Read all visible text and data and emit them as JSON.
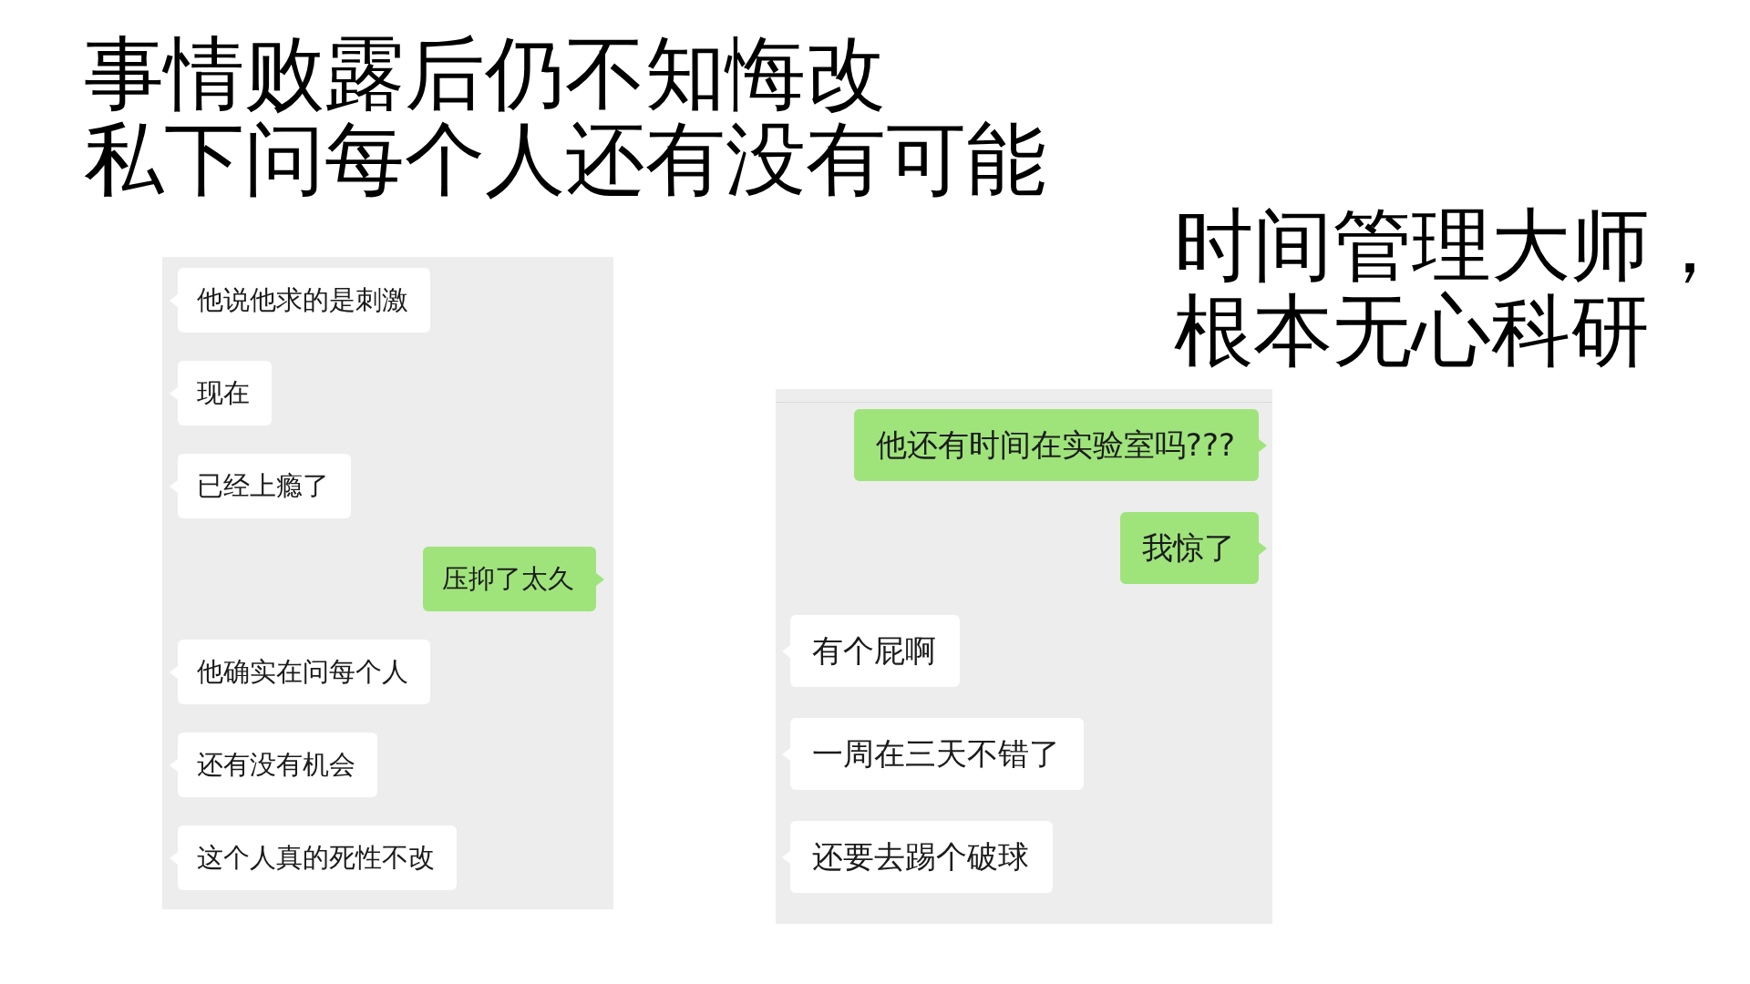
{
  "headline": {
    "lines": [
      "事情败露后仍不知悔改",
      "私下问每个人还有没有可能"
    ]
  },
  "chats": [
    {
      "messages": [
        {
          "kind": "received",
          "text": "他说他求的是刺激"
        },
        {
          "kind": "received",
          "text": "现在"
        },
        {
          "kind": "received",
          "text": "已经上瘾了"
        },
        {
          "kind": "sent",
          "text": "压抑了太久"
        },
        {
          "kind": "received",
          "text": "他确实在问每个人"
        },
        {
          "kind": "received",
          "text": "还有没有机会"
        },
        {
          "kind": "received",
          "text": "这个人真的死性不改"
        }
      ]
    },
    {
      "messages": [
        {
          "kind": "sent",
          "text": "他还有时间在实验室吗???"
        },
        {
          "kind": "sent",
          "text": "我惊了"
        },
        {
          "kind": "received",
          "text": "有个屁啊"
        },
        {
          "kind": "received",
          "text": "一周在三天不错了"
        },
        {
          "kind": "received",
          "text": "还要去踢个破球"
        }
      ]
    }
  ],
  "side_note": {
    "lines": [
      "时间管理大师，",
      "根本无心科研"
    ]
  }
}
